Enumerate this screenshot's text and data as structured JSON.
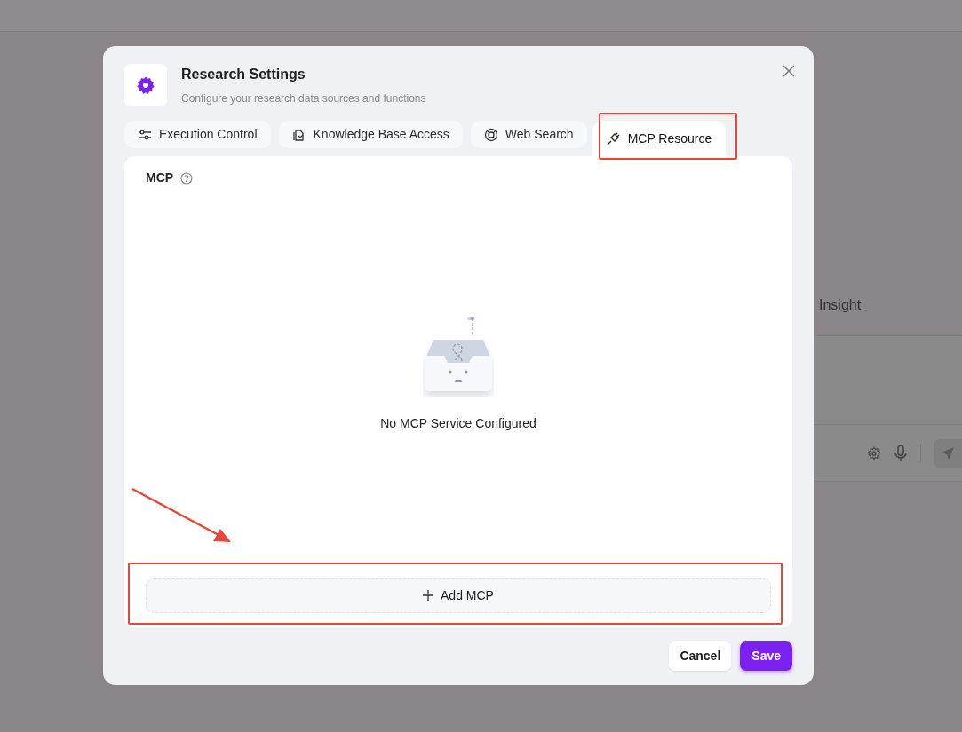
{
  "background": {
    "heading": "Insight"
  },
  "modal": {
    "title": "Research Settings",
    "subtitle": "Configure your research data sources and functions",
    "tabs": [
      {
        "label": "Execution Control",
        "selected": false
      },
      {
        "label": "Knowledge Base Access",
        "selected": false
      },
      {
        "label": "Web Search",
        "selected": false
      },
      {
        "label": "MCP Resource",
        "selected": true
      }
    ],
    "panel": {
      "section_label": "MCP",
      "empty_text": "No MCP Service Configured",
      "add_button": "Add MCP"
    },
    "buttons": {
      "cancel": "Cancel",
      "save": "Save"
    }
  }
}
